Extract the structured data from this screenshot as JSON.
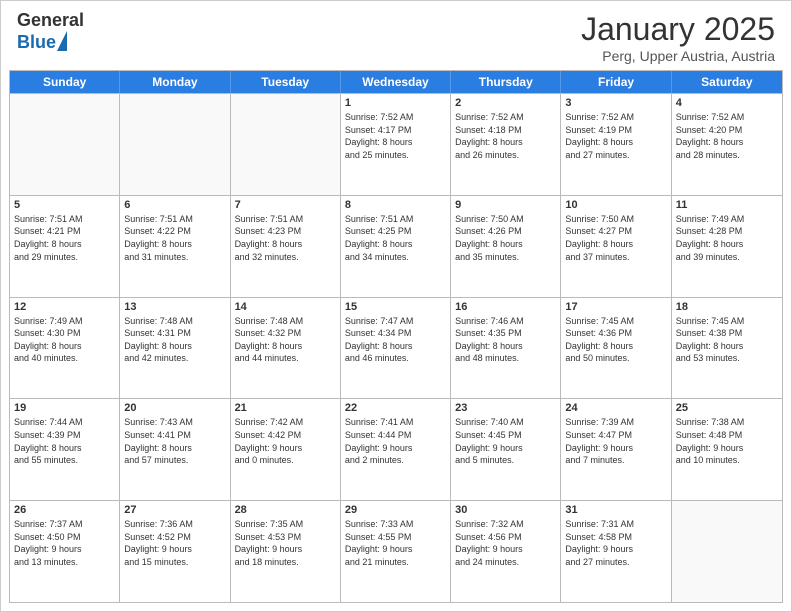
{
  "header": {
    "logo_general": "General",
    "logo_blue": "Blue",
    "month": "January 2025",
    "location": "Perg, Upper Austria, Austria"
  },
  "weekdays": [
    "Sunday",
    "Monday",
    "Tuesday",
    "Wednesday",
    "Thursday",
    "Friday",
    "Saturday"
  ],
  "weeks": [
    [
      {
        "day": "",
        "info": ""
      },
      {
        "day": "",
        "info": ""
      },
      {
        "day": "",
        "info": ""
      },
      {
        "day": "1",
        "info": "Sunrise: 7:52 AM\nSunset: 4:17 PM\nDaylight: 8 hours\nand 25 minutes."
      },
      {
        "day": "2",
        "info": "Sunrise: 7:52 AM\nSunset: 4:18 PM\nDaylight: 8 hours\nand 26 minutes."
      },
      {
        "day": "3",
        "info": "Sunrise: 7:52 AM\nSunset: 4:19 PM\nDaylight: 8 hours\nand 27 minutes."
      },
      {
        "day": "4",
        "info": "Sunrise: 7:52 AM\nSunset: 4:20 PM\nDaylight: 8 hours\nand 28 minutes."
      }
    ],
    [
      {
        "day": "5",
        "info": "Sunrise: 7:51 AM\nSunset: 4:21 PM\nDaylight: 8 hours\nand 29 minutes."
      },
      {
        "day": "6",
        "info": "Sunrise: 7:51 AM\nSunset: 4:22 PM\nDaylight: 8 hours\nand 31 minutes."
      },
      {
        "day": "7",
        "info": "Sunrise: 7:51 AM\nSunset: 4:23 PM\nDaylight: 8 hours\nand 32 minutes."
      },
      {
        "day": "8",
        "info": "Sunrise: 7:51 AM\nSunset: 4:25 PM\nDaylight: 8 hours\nand 34 minutes."
      },
      {
        "day": "9",
        "info": "Sunrise: 7:50 AM\nSunset: 4:26 PM\nDaylight: 8 hours\nand 35 minutes."
      },
      {
        "day": "10",
        "info": "Sunrise: 7:50 AM\nSunset: 4:27 PM\nDaylight: 8 hours\nand 37 minutes."
      },
      {
        "day": "11",
        "info": "Sunrise: 7:49 AM\nSunset: 4:28 PM\nDaylight: 8 hours\nand 39 minutes."
      }
    ],
    [
      {
        "day": "12",
        "info": "Sunrise: 7:49 AM\nSunset: 4:30 PM\nDaylight: 8 hours\nand 40 minutes."
      },
      {
        "day": "13",
        "info": "Sunrise: 7:48 AM\nSunset: 4:31 PM\nDaylight: 8 hours\nand 42 minutes."
      },
      {
        "day": "14",
        "info": "Sunrise: 7:48 AM\nSunset: 4:32 PM\nDaylight: 8 hours\nand 44 minutes."
      },
      {
        "day": "15",
        "info": "Sunrise: 7:47 AM\nSunset: 4:34 PM\nDaylight: 8 hours\nand 46 minutes."
      },
      {
        "day": "16",
        "info": "Sunrise: 7:46 AM\nSunset: 4:35 PM\nDaylight: 8 hours\nand 48 minutes."
      },
      {
        "day": "17",
        "info": "Sunrise: 7:45 AM\nSunset: 4:36 PM\nDaylight: 8 hours\nand 50 minutes."
      },
      {
        "day": "18",
        "info": "Sunrise: 7:45 AM\nSunset: 4:38 PM\nDaylight: 8 hours\nand 53 minutes."
      }
    ],
    [
      {
        "day": "19",
        "info": "Sunrise: 7:44 AM\nSunset: 4:39 PM\nDaylight: 8 hours\nand 55 minutes."
      },
      {
        "day": "20",
        "info": "Sunrise: 7:43 AM\nSunset: 4:41 PM\nDaylight: 8 hours\nand 57 minutes."
      },
      {
        "day": "21",
        "info": "Sunrise: 7:42 AM\nSunset: 4:42 PM\nDaylight: 9 hours\nand 0 minutes."
      },
      {
        "day": "22",
        "info": "Sunrise: 7:41 AM\nSunset: 4:44 PM\nDaylight: 9 hours\nand 2 minutes."
      },
      {
        "day": "23",
        "info": "Sunrise: 7:40 AM\nSunset: 4:45 PM\nDaylight: 9 hours\nand 5 minutes."
      },
      {
        "day": "24",
        "info": "Sunrise: 7:39 AM\nSunset: 4:47 PM\nDaylight: 9 hours\nand 7 minutes."
      },
      {
        "day": "25",
        "info": "Sunrise: 7:38 AM\nSunset: 4:48 PM\nDaylight: 9 hours\nand 10 minutes."
      }
    ],
    [
      {
        "day": "26",
        "info": "Sunrise: 7:37 AM\nSunset: 4:50 PM\nDaylight: 9 hours\nand 13 minutes."
      },
      {
        "day": "27",
        "info": "Sunrise: 7:36 AM\nSunset: 4:52 PM\nDaylight: 9 hours\nand 15 minutes."
      },
      {
        "day": "28",
        "info": "Sunrise: 7:35 AM\nSunset: 4:53 PM\nDaylight: 9 hours\nand 18 minutes."
      },
      {
        "day": "29",
        "info": "Sunrise: 7:33 AM\nSunset: 4:55 PM\nDaylight: 9 hours\nand 21 minutes."
      },
      {
        "day": "30",
        "info": "Sunrise: 7:32 AM\nSunset: 4:56 PM\nDaylight: 9 hours\nand 24 minutes."
      },
      {
        "day": "31",
        "info": "Sunrise: 7:31 AM\nSunset: 4:58 PM\nDaylight: 9 hours\nand 27 minutes."
      },
      {
        "day": "",
        "info": ""
      }
    ]
  ]
}
